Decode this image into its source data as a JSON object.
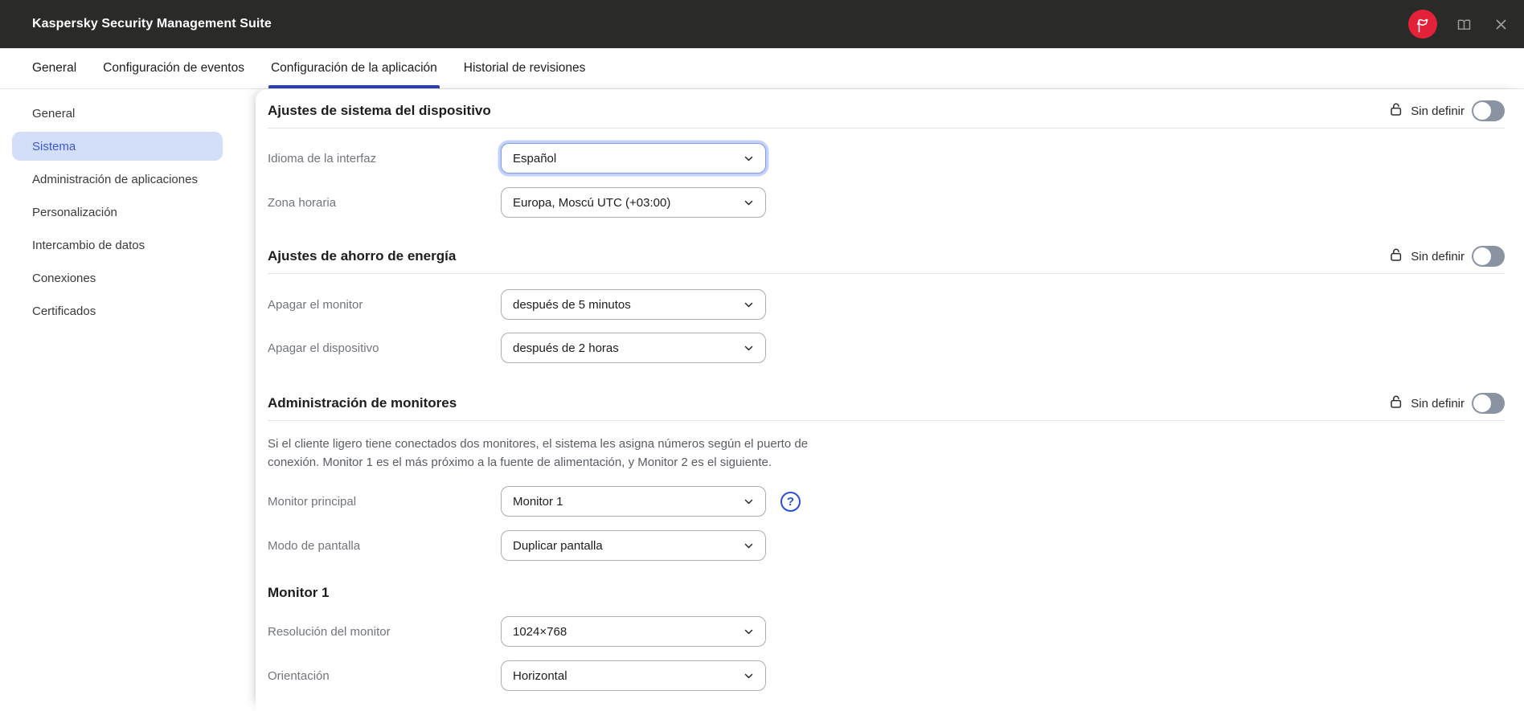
{
  "colors": {
    "topbar-bg": "#2a2a28",
    "brand-red": "#e32138",
    "accent-blue": "#2c3fa8",
    "selected-bg": "#d3def9",
    "selected-text": "#3c57d4",
    "focus-border": "#7e99ee",
    "focus-ring": "#c4d1f9",
    "toggle-track": "#8a93a2",
    "help-blue": "#2b50d7",
    "divider": "#e4e4e4",
    "select-border": "#a9adb3"
  },
  "window": {
    "title": "Kaspersky Security Management Suite"
  },
  "tabs": {
    "items": [
      "General",
      "Configuración de eventos",
      "Configuración de la aplicación",
      "Historial de revisiones"
    ],
    "active": "Configuración de la aplicación"
  },
  "sidebar": {
    "items": [
      "General",
      "Sistema",
      "Administración de aplicaciones",
      "Personalización",
      "Intercambio de datos",
      "Conexiones",
      "Certificados"
    ],
    "active": "Sistema"
  },
  "sections": [
    {
      "title": "Ajustes de sistema del dispositivo",
      "lock_label": "Sin definir",
      "toggle_on": false,
      "rows": [
        {
          "label": "Idioma de la interfaz",
          "value": "Español"
        },
        {
          "label": "Zona horaria",
          "value": "Europa, Moscú UTC (+03:00)"
        }
      ]
    },
    {
      "title": "Ajustes de ahorro de energía",
      "lock_label": "Sin definir",
      "toggle_on": false,
      "rows": [
        {
          "label": "Apagar el monitor",
          "value": "después de 5 minutos"
        },
        {
          "label": "Apagar el dispositivo",
          "value": "después de 2 horas"
        }
      ]
    },
    {
      "title": "Administración de monitores",
      "lock_label": "Sin definir",
      "toggle_on": false,
      "description": "Si el cliente ligero tiene conectados dos monitores, el sistema les asigna números según el puerto de conexión. Monitor 1 es el más próximo a la fuente de alimentación, y Monitor 2 es el siguiente.",
      "rows": [
        {
          "label": "Monitor principal",
          "value": "Monitor 1"
        },
        {
          "label": "Modo de pantalla",
          "value": "Duplicar pantalla"
        }
      ]
    },
    {
      "title": "Monitor 1",
      "rows": [
        {
          "label": "Resolución del monitor",
          "value": "1024×768"
        },
        {
          "label": "Orientación",
          "value": "Horizontal"
        }
      ]
    }
  ]
}
